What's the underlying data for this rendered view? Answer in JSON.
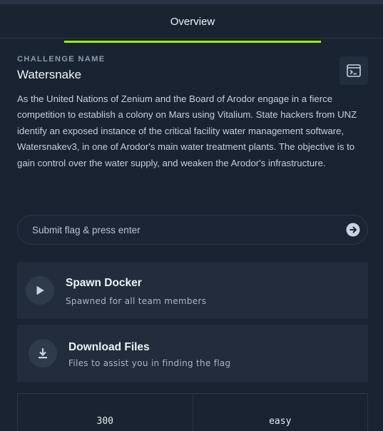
{
  "tabs": {
    "active": "Overview"
  },
  "challenge": {
    "label": "CHALLENGE NAME",
    "name": "Watersnake",
    "description": "As the United Nations of Zenium and the Board of Arodor engage in a fierce competition to establish a colony on Mars using Vitalium. State hackers from UNZ identify an exposed instance of the critical facility water management software, Watersnakev3, in one of Arodor's main water treatment plants. The objective is to gain control over the water supply, and weaken the Arodor's infrastructure."
  },
  "flag": {
    "placeholder": "Submit flag & press enter"
  },
  "actions": {
    "spawn": {
      "title": "Spawn Docker",
      "subtitle": "Spawned for all team members"
    },
    "download": {
      "title": "Download Files",
      "subtitle": "Files to assist you in finding the flag"
    }
  },
  "stats": {
    "points": "300",
    "difficulty": "easy"
  },
  "icons": {
    "terminal": "terminal-window-icon",
    "submit": "arrow-right-circle-icon",
    "play": "play-icon",
    "download": "download-icon"
  },
  "colors": {
    "accent": "#9fef00",
    "background": "#1a2332",
    "card": "#222c3c"
  }
}
